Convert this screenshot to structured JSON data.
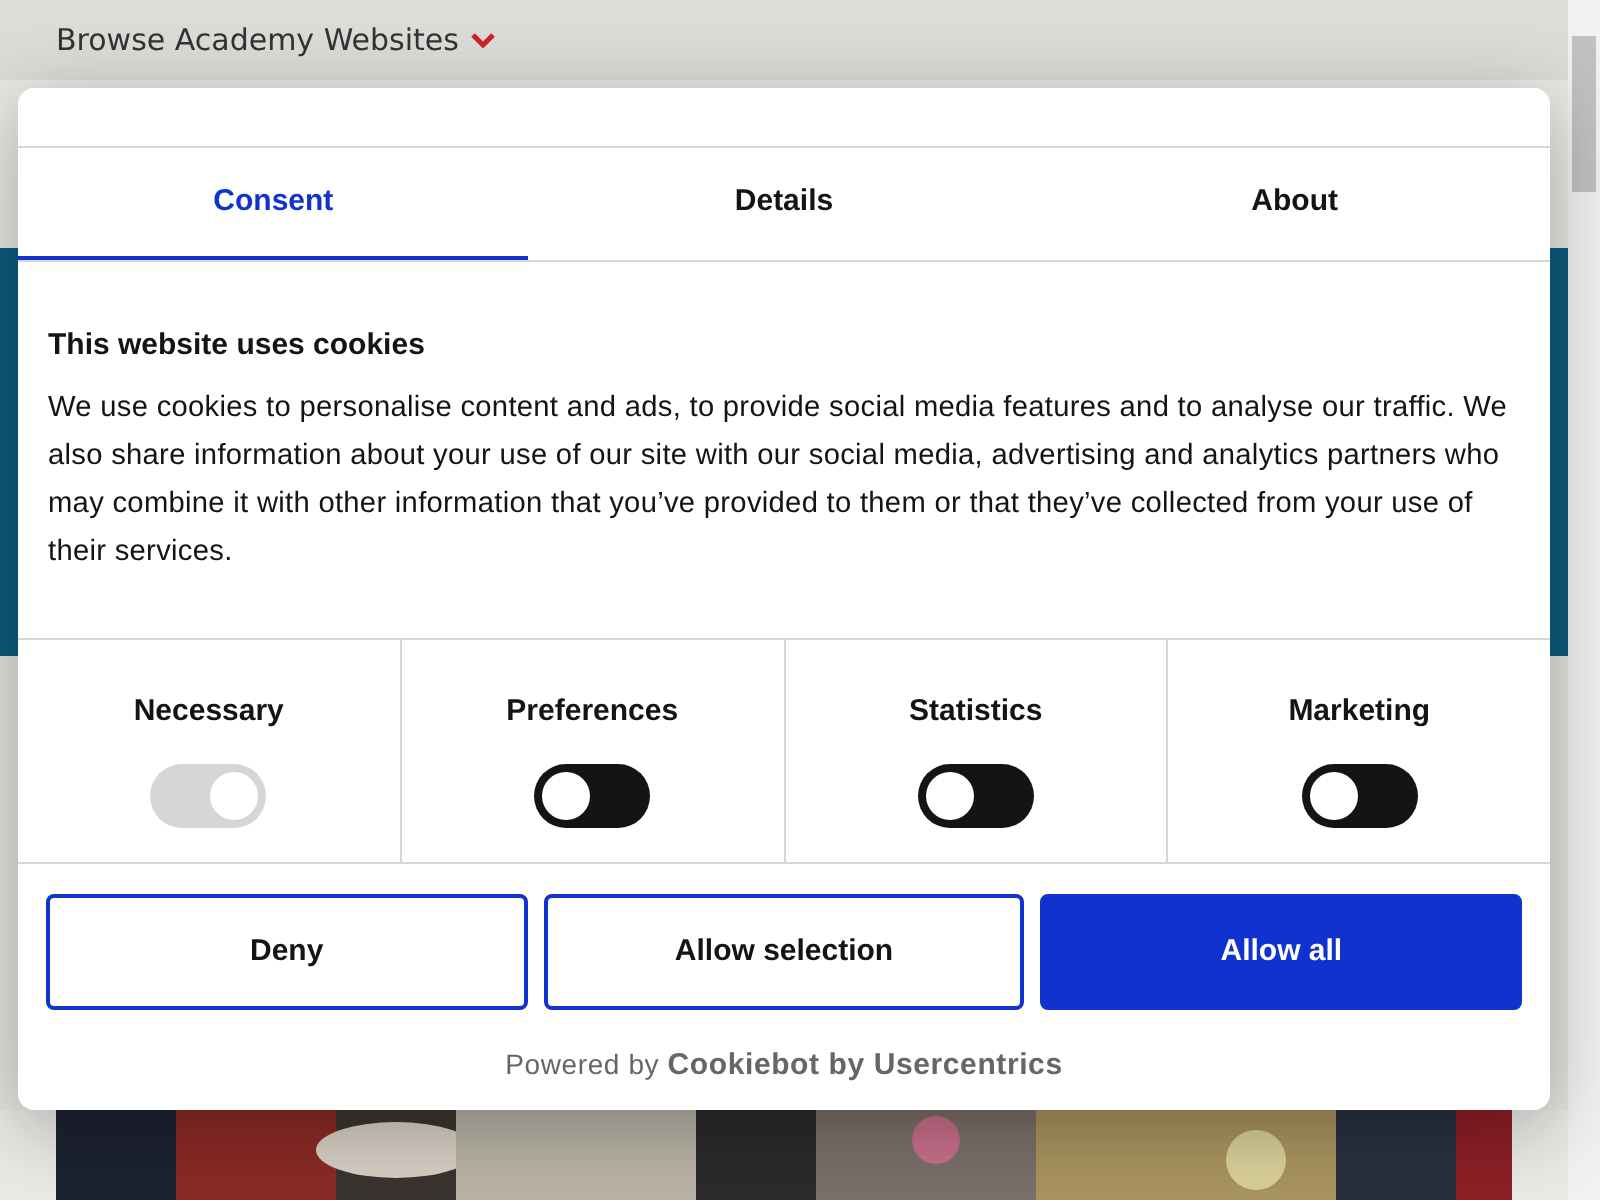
{
  "site_bar": {
    "label": "Browse Academy Websites"
  },
  "tabs": [
    {
      "label": "Consent",
      "selected": true
    },
    {
      "label": "Details",
      "selected": false
    },
    {
      "label": "About",
      "selected": false
    }
  ],
  "notice": {
    "title": "This website uses cookies",
    "text": "We use cookies to personalise content and ads, to provide social media features and to analyse our traffic. We also share information about your use of our site with our social media, advertising and analytics partners who may combine it with other information that you’ve provided to them or that they’ve collected from your use of their services."
  },
  "categories": [
    {
      "label": "Necessary",
      "checked": true,
      "disabled": true
    },
    {
      "label": "Preferences",
      "checked": false,
      "disabled": false
    },
    {
      "label": "Statistics",
      "checked": false,
      "disabled": false
    },
    {
      "label": "Marketing",
      "checked": false,
      "disabled": false
    }
  ],
  "buttons": [
    {
      "label": "Deny",
      "kind": "outline"
    },
    {
      "label": "Allow selection",
      "kind": "outline"
    },
    {
      "label": "Allow all",
      "kind": "primary"
    }
  ],
  "footer": "Powered by **Cookiebot by Usercentrics**"
}
